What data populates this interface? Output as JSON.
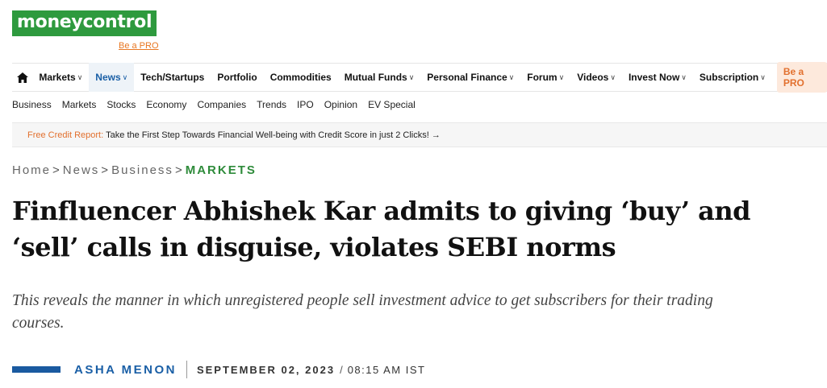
{
  "logo": {
    "part1": "money",
    "part2": "control",
    "tagline": "Be a PRO"
  },
  "nav": {
    "items": [
      {
        "label": "Markets",
        "chevron": true,
        "active": false
      },
      {
        "label": "News",
        "chevron": true,
        "active": true
      },
      {
        "label": "Tech/Startups",
        "chevron": false,
        "active": false
      },
      {
        "label": "Portfolio",
        "chevron": false,
        "active": false
      },
      {
        "label": "Commodities",
        "chevron": false,
        "active": false
      },
      {
        "label": "Mutual Funds",
        "chevron": true,
        "active": false
      },
      {
        "label": "Personal Finance",
        "chevron": true,
        "active": false
      },
      {
        "label": "Forum",
        "chevron": true,
        "active": false
      },
      {
        "label": "Videos",
        "chevron": true,
        "active": false
      },
      {
        "label": "Invest Now",
        "chevron": true,
        "active": false
      },
      {
        "label": "Subscription",
        "chevron": true,
        "active": false
      }
    ],
    "pro_label": "Be a PRO"
  },
  "subnav": [
    "Business",
    "Markets",
    "Stocks",
    "Economy",
    "Companies",
    "Trends",
    "IPO",
    "Opinion",
    "EV Special"
  ],
  "banner": {
    "highlight": "Free Credit Report:",
    "text": "Take the First Step Towards Financial Well-being with Credit Score in just 2 Clicks! →"
  },
  "breadcrumb": {
    "home": "Home",
    "news": "News",
    "business": "Business",
    "current": "MARKETS",
    "separator": ">"
  },
  "article": {
    "headline": "Finfluencer Abhishek Kar admits to giving ‘buy’ and ‘sell’ calls in disguise, violates SEBI norms",
    "summary": "This reveals the manner in which unregistered people sell investment advice to get subscribers for their trading courses.",
    "author": "ASHA MENON",
    "date": "SEPTEMBER 02, 2023",
    "date_separator": "/",
    "time": "08:15 AM IST"
  },
  "colors": {
    "brand_green": "#2e9a3e",
    "accent_orange": "#e2702e",
    "link_blue": "#1a5fa6"
  }
}
